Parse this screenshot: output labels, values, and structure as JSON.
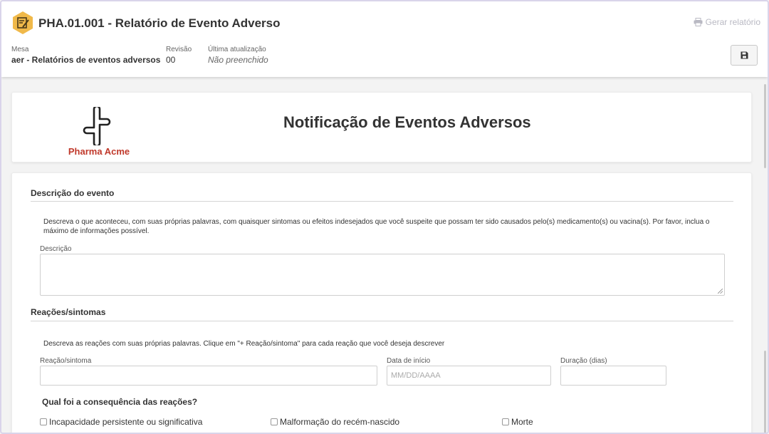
{
  "header": {
    "title": "PHA.01.001 - Relatório de Evento Adverso",
    "report_button": "Gerar relatório",
    "icon": "edit-document-icon",
    "meta": {
      "mesa_label": "Mesa",
      "mesa_value": "aer - Relatórios de eventos adversos",
      "revisao_label": "Revisão",
      "revisao_value": "00",
      "atualizacao_label": "Última atualização",
      "atualizacao_value": "Não preenchido"
    },
    "save_icon": "floppy-disk-icon"
  },
  "document": {
    "logo_text": "Pharma Acme",
    "title": "Notificação de Eventos Adversos"
  },
  "form": {
    "section_event": "Descrição do evento",
    "event_help": "Descreva o que aconteceu, com suas próprias palavras, com quaisquer sintomas ou efeitos indesejados que você suspeite que possam ter sido causados pelo(s) medicamento(s) ou vacina(s). Por favor, inclua o máximo de informações possível.",
    "description_label": "Descrição",
    "description_value": "",
    "section_reactions": "Reações/sintomas",
    "reactions_help": "Descreva as reações com suas próprias palavras. Clique em \"+ Reação/sintoma\" para cada reação que você deseja descrever",
    "reaction_label": "Reação/sintoma",
    "reaction_value": "",
    "start_date_label": "Data de início",
    "start_date_placeholder": "MM/DD/AAAA",
    "duration_label": "Duração (dias)",
    "duration_value": "",
    "consequence_question": "Qual foi a consequência das reações?",
    "consequences": [
      {
        "label": "Incapacidade persistente ou significativa",
        "checked": false
      },
      {
        "label": "Malformação do recém-nascido",
        "checked": false
      },
      {
        "label": "Morte",
        "checked": false
      }
    ]
  },
  "colors": {
    "brand_icon": "#f0b94a",
    "logo_red": "#c0392b"
  }
}
